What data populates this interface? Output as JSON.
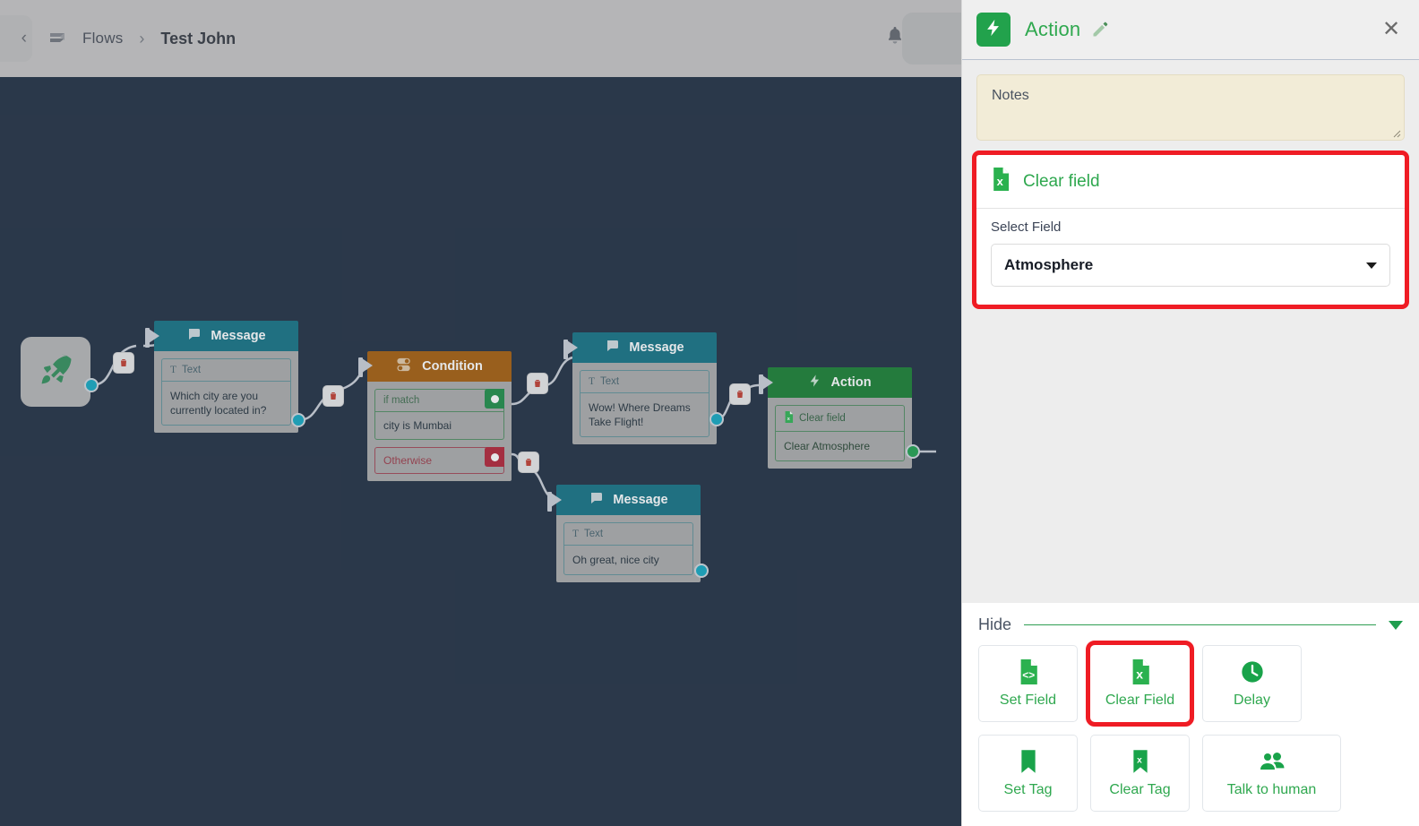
{
  "topbar": {
    "back_icon": "chevron-left-icon",
    "flows_icon": "flows-logo-icon",
    "flows_label": "Flows",
    "separator": "›",
    "current_label": "Test John",
    "bell_icon": "bell-icon"
  },
  "canvas": {
    "start_node": {
      "icon": "rocket-icon"
    },
    "nodes": [
      {
        "type": "message",
        "title": "Message",
        "icon": "chat-bubble-icon",
        "field_label": "Text",
        "field_label_icon": "text-T-icon",
        "field_value": "Which city are you currently located in?"
      },
      {
        "type": "condition",
        "title": "Condition",
        "icon": "toggle-switch-icon",
        "if_label": "if match",
        "if_value": "city is Mumbai",
        "otherwise_label": "Otherwise"
      },
      {
        "type": "message",
        "title": "Message",
        "icon": "chat-bubble-icon",
        "field_label": "Text",
        "field_label_icon": "text-T-icon",
        "field_value": "Wow! Where Dreams Take Flight!"
      },
      {
        "type": "message",
        "title": "Message",
        "icon": "chat-bubble-icon",
        "field_label": "Text",
        "field_label_icon": "text-T-icon",
        "field_value": "Oh great, nice city"
      },
      {
        "type": "action",
        "title": "Action",
        "icon": "lightning-bolt-icon",
        "field_label": "Clear field",
        "field_label_icon": "clear-field-doc-icon",
        "field_value": "Clear Atmosphere"
      }
    ],
    "delete_icon": "trash-icon"
  },
  "panel": {
    "badge_icon": "lightning-bolt-icon",
    "title": "Action",
    "edit_icon": "pencil-icon",
    "close_icon": "close-icon",
    "notes": {
      "placeholder": "Notes",
      "value": "",
      "resize_icon": "resize-handle-icon"
    },
    "clear_field_card": {
      "icon": "clear-field-doc-icon",
      "title": "Clear field",
      "select_label": "Select Field",
      "selected_value": "Atmosphere",
      "caret_icon": "chevron-down-icon",
      "highlight_color": "#EF1C24"
    },
    "footer": {
      "hide_label": "Hide",
      "collapse_icon": "chevron-down-icon",
      "tiles": [
        {
          "label": "Set Field",
          "icon": "set-field-doc-icon",
          "selected": false
        },
        {
          "label": "Clear Field",
          "icon": "clear-field-doc-icon",
          "selected": true
        },
        {
          "label": "Delay",
          "icon": "clock-icon",
          "selected": false
        },
        {
          "label": "Set Tag",
          "icon": "bookmark-icon",
          "selected": false
        },
        {
          "label": "Clear Tag",
          "icon": "bookmark-x-icon",
          "selected": false
        },
        {
          "label": "Talk to human",
          "icon": "people-icon",
          "selected": false
        }
      ]
    }
  },
  "colors": {
    "accent_green": "#2FA84F",
    "highlight_red": "#EF1C24",
    "canvas_bg": "#1C2A3D",
    "message_header": "#0F6E80",
    "condition_header": "#A35A07",
    "action_header": "#147C2E",
    "notes_bg": "#F2ECD7"
  }
}
